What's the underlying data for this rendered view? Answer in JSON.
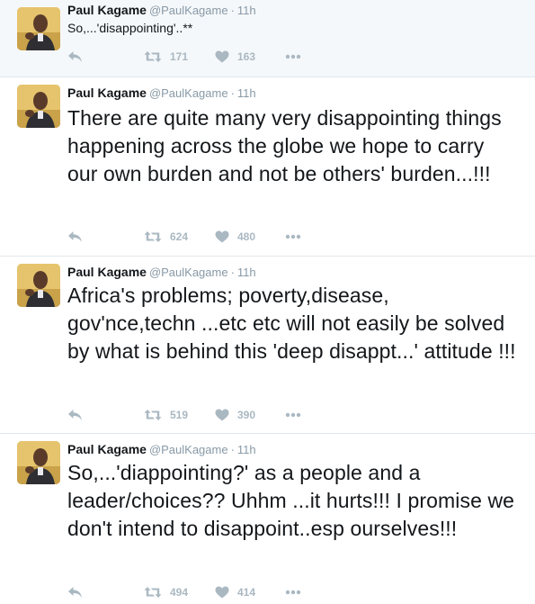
{
  "author": {
    "name": "Paul Kagame",
    "handle": "@PaulKagame"
  },
  "separator": "·",
  "tweets": [
    {
      "time": "11h",
      "text": "So,...'disappointing'..**",
      "retweets": "171",
      "likes": "163"
    },
    {
      "time": "11h",
      "text": "There are quite many very disappointing things happening across the globe we hope to carry our own burden and not be others' burden...!!!",
      "retweets": "624",
      "likes": "480"
    },
    {
      "time": "11h",
      "text": "Africa's problems; poverty,disease, gov'nce,techn ...etc etc will not easily be solved by what is behind this 'deep disappt...' attitude !!!",
      "retweets": "519",
      "likes": "390"
    },
    {
      "time": "11h",
      "text": "So,...'diappointing?' as a people and a leader/choices?? Uhhm ...it hurts!!! I promise we don't intend to disappoint..esp ourselves!!!",
      "retweets": "494",
      "likes": "414"
    }
  ],
  "icons": {
    "reply": "reply-icon",
    "retweet": "retweet-icon",
    "like": "heart-icon",
    "more": "more-dots-icon"
  },
  "colors": {
    "name": "#14171a",
    "meta": "#8899a6",
    "action": "#aab8c2",
    "divider": "#e1e8ed",
    "highlight_bg": "#f5f8fa"
  }
}
